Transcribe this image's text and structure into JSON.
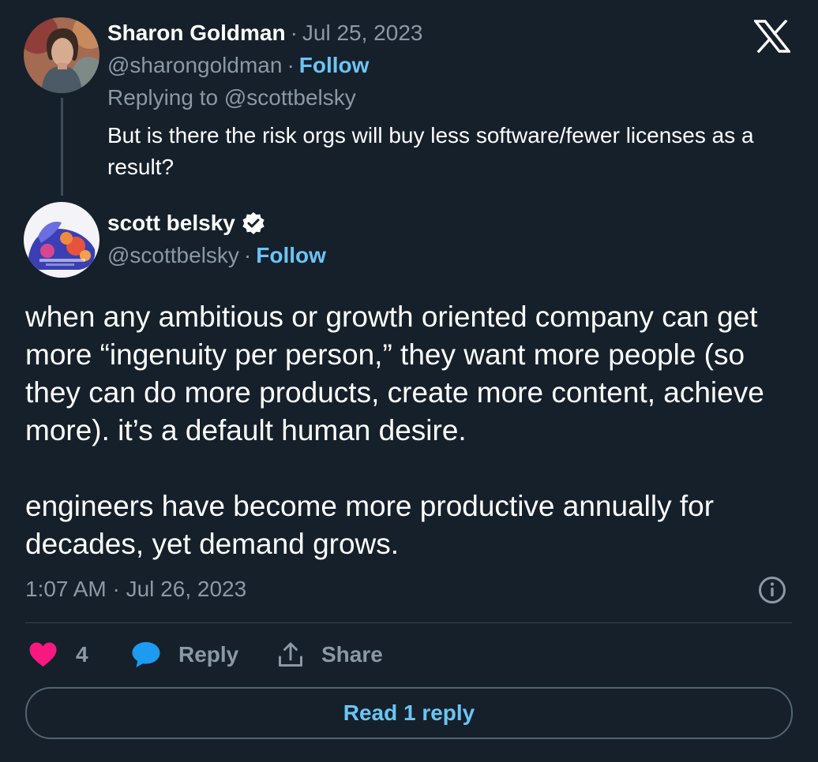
{
  "parent_tweet": {
    "author_name": "Sharon Goldman",
    "date": "Jul 25, 2023",
    "handle": "@sharongoldman",
    "follow_label": "Follow",
    "replying_to": "Replying to @scottbelsky",
    "text": "But is there the risk orgs will buy less software/fewer licenses as a result?"
  },
  "main_tweet": {
    "author_name": "scott belsky",
    "verified": true,
    "handle": "@scottbelsky",
    "follow_label": "Follow",
    "text": "when any ambitious or growth oriented company can get more “ingenuity per person,” they want more people (so they can do more products, create more content, achieve more). it’s a default human desire.\n\nengineers have become more productive annually for decades, yet demand grows.",
    "timestamp": "1:07 AM · Jul 26, 2023"
  },
  "separator": "·",
  "actions": {
    "like_count": "4",
    "reply_label": "Reply",
    "share_label": "Share"
  },
  "read_replies_label": "Read 1 reply",
  "icons": {
    "brand": "x-logo-icon",
    "like": "heart-icon",
    "reply": "speech-bubble-icon",
    "share": "share-upload-icon",
    "info": "info-icon",
    "verified": "verified-badge-icon"
  },
  "colors": {
    "background": "#15202b",
    "accent_blue": "#1d9bf0",
    "like_pink": "#f91880",
    "muted_text": "#8b98a5"
  }
}
